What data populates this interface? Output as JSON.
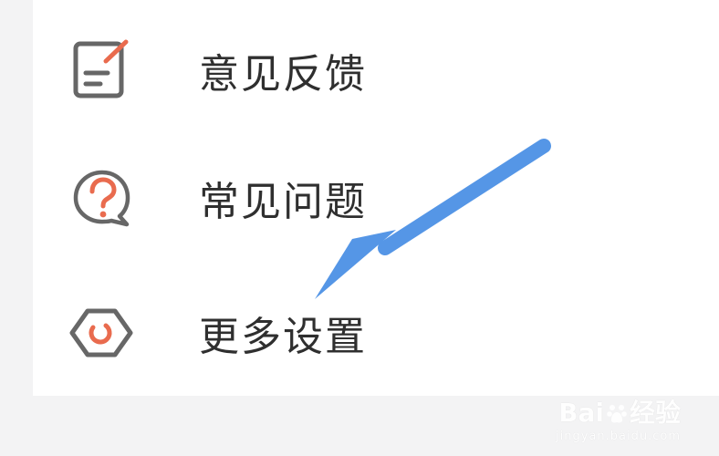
{
  "menu": {
    "items": [
      {
        "label": "意见反馈",
        "icon": "feedback-icon"
      },
      {
        "label": "常见问题",
        "icon": "faq-icon"
      },
      {
        "label": "更多设置",
        "icon": "more-settings-icon"
      }
    ]
  },
  "annotation": {
    "icon": "pointer-arrow-icon",
    "color": "#5596e6"
  },
  "watermark": {
    "brand": "Bai",
    "suffix": "经验",
    "url": "jingyan.baidu.com"
  },
  "colors": {
    "accent": "#e96b4e",
    "icon_gray": "#676767",
    "text": "#2f2f2f",
    "background": "#f3f3f4",
    "card": "#ffffff"
  }
}
